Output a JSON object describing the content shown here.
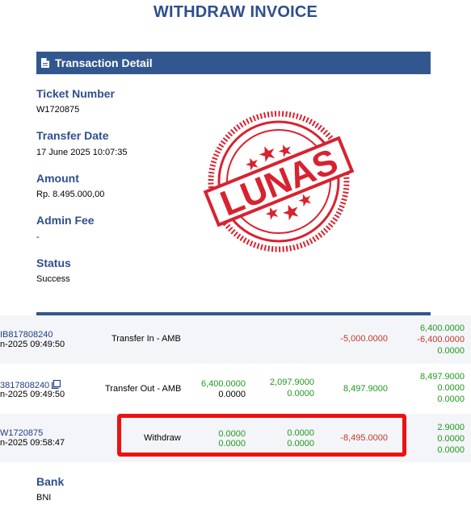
{
  "page_title": "WITHDRAW INVOICE",
  "section": {
    "title": "Transaction Detail",
    "icon": "document-icon"
  },
  "fields": {
    "ticket_label": "Ticket Number",
    "ticket_value": "W1720875",
    "date_label": "Transfer Date",
    "date_value": "17 June 2025 10:07:35",
    "amount_label": "Amount",
    "amount_value": "Rp. 8.495.000,00",
    "fee_label": "Admin Fee",
    "fee_value": "-",
    "status_label": "Status",
    "status_value": "Success",
    "bank_label": "Bank",
    "bank_value": "BNI"
  },
  "stamp": {
    "text": "LUNAS",
    "color": "#d8222f"
  },
  "transactions": [
    {
      "id": "IB817808240",
      "timestamp": "n-2025 09:49:50",
      "type": "Transfer In - AMB",
      "c1a": "",
      "c1b": "",
      "c2a": "",
      "c2b": "",
      "amount": "-5,000.0000",
      "bal1": "6,400.0000",
      "bal2": "-6,400.0000",
      "bal3": "0.0000"
    },
    {
      "id": "3817808240",
      "timestamp": "n-2025 09:49:50",
      "type": "Transfer Out - AMB",
      "c1a": "6,400.0000",
      "c1b": "0.0000",
      "c2a": "2,097.9000",
      "c2b": "0.0000",
      "amount": "8,497.9000",
      "bal1": "8,497.9000",
      "bal2": "0.0000",
      "bal3": "0.0000"
    },
    {
      "id": "W1720875",
      "timestamp": "n-2025 09:58:47",
      "type": "Withdraw",
      "c1a": "0.0000",
      "c1b": "0.0000",
      "c2a": "0.0000",
      "c2b": "0.0000",
      "amount": "-8,495.0000",
      "bal1": "2.9000",
      "bal2": "0.0000",
      "bal3": "0.0000"
    }
  ],
  "colors": {
    "header_blue": "#32578f",
    "label_blue": "#2e4f8e",
    "positive": "#1e9a1e",
    "negative": "#c0392b",
    "highlight": "#ee1111"
  }
}
